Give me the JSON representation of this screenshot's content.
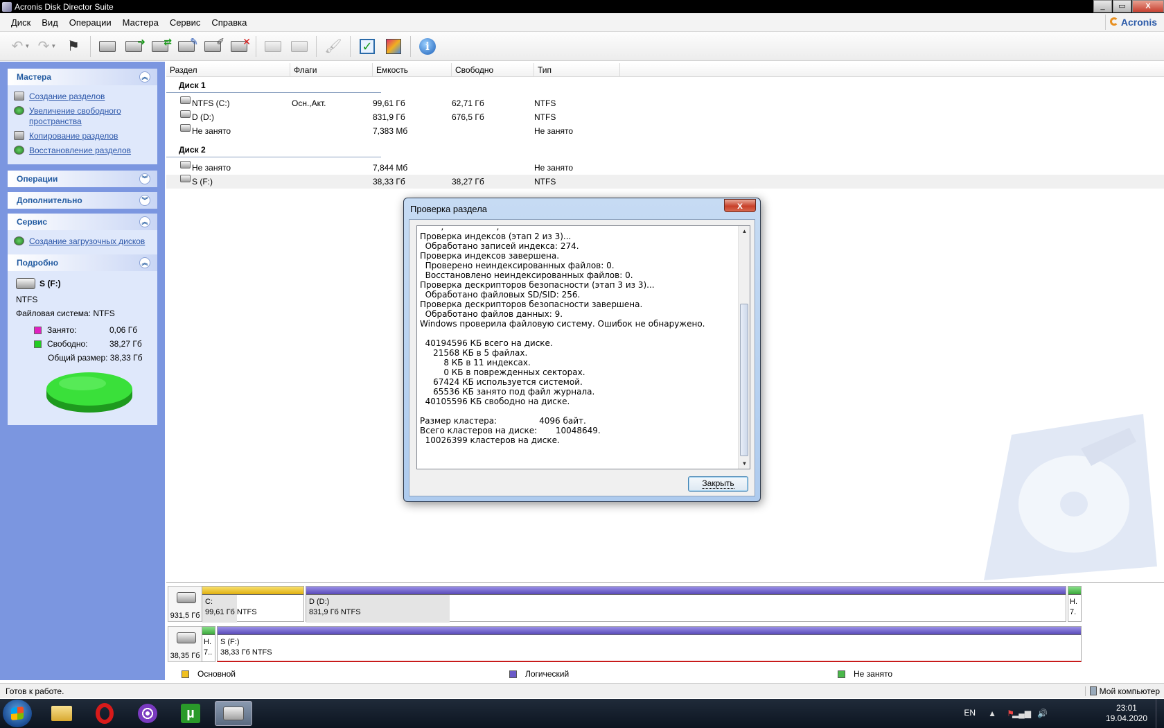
{
  "window": {
    "title": "Acronis Disk Director Suite",
    "min": "_",
    "max": "▭",
    "close": "X"
  },
  "menu": [
    "Диск",
    "Вид",
    "Операции",
    "Мастера",
    "Сервис",
    "Справка"
  ],
  "brand": "Acronis",
  "sidebar": {
    "wizards": {
      "title": "Мастера",
      "items": [
        "Создание разделов",
        "Увеличение свободного пространства",
        "Копирование разделов",
        "Восстановление разделов"
      ]
    },
    "operations": {
      "title": "Операции"
    },
    "additional": {
      "title": "Дополнительно"
    },
    "service": {
      "title": "Сервис",
      "items": [
        "Создание загрузочных дисков"
      ]
    },
    "details": {
      "title": "Подробно",
      "partition": "S (F:)",
      "fs_short": "NTFS",
      "fs_full": "Файловая система: NTFS",
      "used_label": "Занято:",
      "used_value": "0,06 Гб",
      "free_label": "Свободно:",
      "free_value": "38,27 Гб",
      "total": "Общий размер: 38,33 Гб",
      "used_color": "#e020c0",
      "free_color": "#22cc22"
    }
  },
  "columns": [
    "Раздел",
    "Флаги",
    "Емкость",
    "Свободно",
    "Тип"
  ],
  "disks": [
    {
      "name": "Диск 1",
      "partitions": [
        {
          "name": "NTFS (C:)",
          "flags": "Осн.,Акт.",
          "capacity": "99,61 Гб",
          "free": "62,71 Гб",
          "type": "NTFS"
        },
        {
          "name": "D (D:)",
          "flags": "",
          "capacity": "831,9 Гб",
          "free": "676,5 Гб",
          "type": "NTFS"
        },
        {
          "name": "Не занято",
          "flags": "",
          "capacity": "7,383 Мб",
          "free": "",
          "type": "Не занято"
        }
      ]
    },
    {
      "name": "Диск 2",
      "partitions": [
        {
          "name": "Не занято",
          "flags": "",
          "capacity": "7,844 Мб",
          "free": "",
          "type": "Не занято"
        },
        {
          "name": "S (F:)",
          "flags": "",
          "capacity": "38,33 Гб",
          "free": "38,27 Гб",
          "type": "NTFS"
        }
      ]
    }
  ],
  "diskmap": {
    "disk1": {
      "size": "931,5 Гб",
      "c_name": "C:",
      "c_info": "99,61 Гб  NTFS",
      "d_name": "D (D:)",
      "d_info": "831,9 Гб  NTFS",
      "u_name": "Н.",
      "u_info": "7."
    },
    "disk2": {
      "size": "38,35 Гб",
      "u_name": "Н.",
      "u_info": "7..",
      "s_name": "S (F:)",
      "s_info": "38,33 Гб   NTFS"
    }
  },
  "legend": {
    "primary": "Основной",
    "logical": "Логический",
    "unallocated": "Не занято",
    "primary_color": "#f0c020",
    "logical_color": "#6a5ac8",
    "unallocated_color": "#4ab84a"
  },
  "status": {
    "text": "Готов к работе.",
    "computer": "Мой компьютер"
  },
  "dialog": {
    "title": "Проверка раздела",
    "close": "x",
    "button": "Закрыть",
    "lines": [
      "        ,                    ,",
      "Проверка индексов (этап 2 из 3)...",
      "  Обработано записей индекса: 274.",
      "Проверка индексов завершена.",
      "  Проверено неиндексированных файлов: 0.",
      "  Восстановлено неиндексированных файлов: 0.",
      "Проверка дескрипторов безопасности (этап 3 из 3)...",
      "  Обработано файловых SD/SID: 256.",
      "Проверка дескрипторов безопасности завершена.",
      "  Обработано файлов данных: 9.",
      "Windows проверила файловую систему. Ошибок не обнаружено.",
      "",
      "  40194596 КБ всего на диске.",
      "     21568 КБ в 5 файлах.",
      "         8 КБ в 11 индексах.",
      "         0 КБ в поврежденных секторах.",
      "     67424 КБ используется системой.",
      "     65536 КБ занято под файл журнала.",
      "  40105596 КБ свободно на диске.",
      "",
      "Размер кластера:                4096 байт.",
      "Всего кластеров на диске:       10048649.",
      "  10026399 кластеров на диске."
    ]
  },
  "taskbar": {
    "lang": "EN",
    "time": "23:01",
    "date": "19.04.2020",
    "utorrent_glyph": "µ"
  }
}
